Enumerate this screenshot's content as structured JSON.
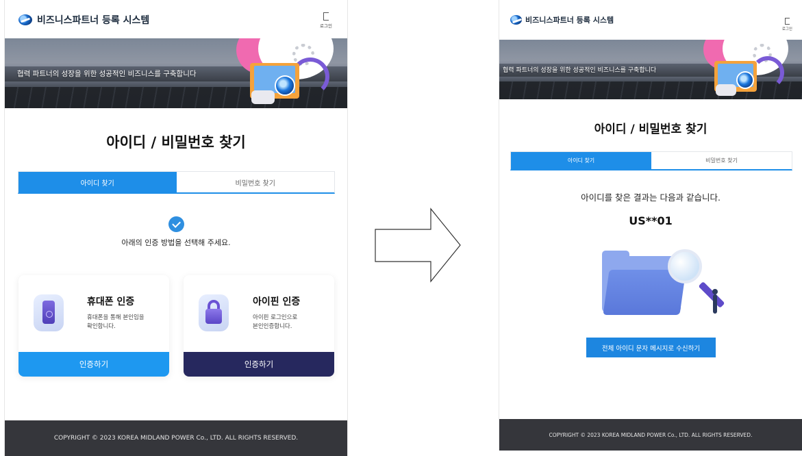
{
  "app": {
    "brand_name": "비즈니스파트너 등록 시스템",
    "login_label": "로그인",
    "banner_tagline": "협력 파트너의 성장을 위한 성공적인 비즈니스를 구축합니다",
    "page_title": "아이디 / 비밀번호 찾기",
    "footer_text": "COPYRIGHT © 2023 KOREA MIDLAND POWER Co., LTD. ALL RIGHTS RESERVED."
  },
  "tabs": {
    "find_id": "아이디 찾기",
    "find_password": "비밀번호 찾기",
    "active": "find_id"
  },
  "left_screen": {
    "guide_text": "아래의 인증 방법을 선택해 주세요.",
    "cards": [
      {
        "title": "휴대폰 인증",
        "desc": "휴대폰을 통해 본인임을\n확인합니다.",
        "button": "인증하기",
        "icon": "phone-icon",
        "button_color": "#1e98f0"
      },
      {
        "title": "아이핀 인증",
        "desc": "아이핀 로그인으로\n본인인증합니다.",
        "button": "인증하기",
        "icon": "lock-icon",
        "button_color": "#26285e"
      }
    ]
  },
  "right_screen": {
    "result_message": "아이디를 찾은 결과는 다음과 같습니다.",
    "result_id": "US**01",
    "sms_button": "전체 아이디 문자 메시지로 수신하기"
  },
  "colors": {
    "accent": "#1e8ee8",
    "navy": "#26285e",
    "footer_bg": "#35363b"
  }
}
